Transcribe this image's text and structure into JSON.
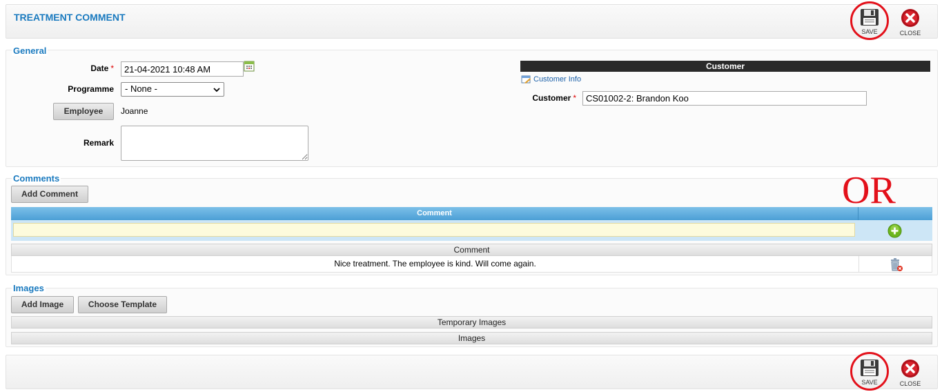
{
  "header": {
    "title": "TREATMENT COMMENT",
    "save_label": "SAVE",
    "close_label": "CLOSE"
  },
  "general": {
    "section_title": "General",
    "date_label": "Date",
    "date_value": "21-04-2021 10:48 AM",
    "programme_label": "Programme",
    "programme_value": "- None -",
    "employee_button": "Employee",
    "employee_value": "Joanne",
    "remark_label": "Remark",
    "remark_value": ""
  },
  "customer": {
    "header": "Customer",
    "info_link": "Customer Info",
    "customer_label": "Customer",
    "customer_value": "CS01002-2: Brandon Koo"
  },
  "comments": {
    "section_title": "Comments",
    "add_button": "Add Comment",
    "grid_header": "Comment",
    "new_comment_value": "",
    "list_header": "Comment",
    "rows": [
      {
        "text": "Nice treatment. The employee is kind. Will come again."
      }
    ]
  },
  "images": {
    "section_title": "Images",
    "add_button": "Add Image",
    "template_button": "Choose Template",
    "temporary_header": "Temporary Images",
    "images_header": "Images"
  },
  "annotation": {
    "or_text": "OR",
    "highlight_color": "#e3101a"
  },
  "footer": {
    "save_label": "SAVE",
    "close_label": "CLOSE"
  }
}
